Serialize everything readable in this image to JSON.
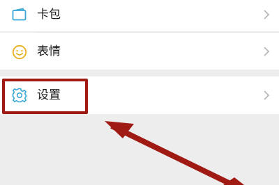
{
  "menu": {
    "items": [
      {
        "label": "卡包",
        "icon": "card-wallet-icon"
      },
      {
        "label": "表情",
        "icon": "smiley-icon"
      },
      {
        "label": "设置",
        "icon": "gear-icon"
      }
    ]
  },
  "colors": {
    "icon_blue": "#3aa7d6",
    "icon_yellow": "#e8b020",
    "annotation_red": "#a01a14",
    "background": "#ededed",
    "row_background": "#ffffff"
  }
}
